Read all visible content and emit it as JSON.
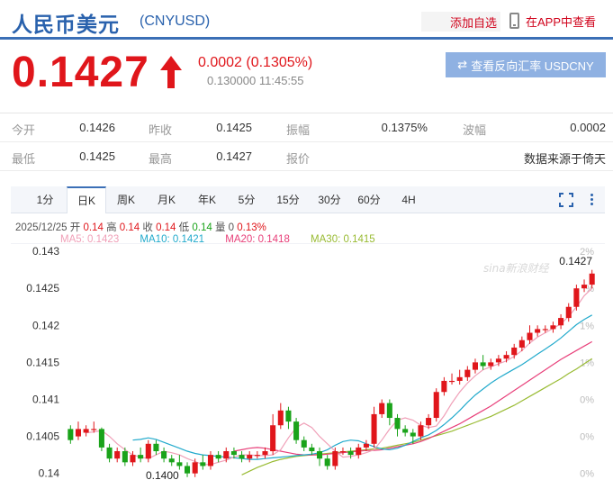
{
  "header": {
    "title": "人民币美元",
    "code": "(CNYUSD)",
    "add_favorite": "添加自选",
    "view_in_app": "在APP中查看"
  },
  "quote": {
    "price": "0.1427",
    "direction": "up",
    "change": "0.0002 (0.1305%)",
    "prev_value": "0.130000",
    "time": "11:45:55",
    "reverse_button": "查看反向汇率 USDCNY",
    "reverse_icon": "swap-arrows-icon",
    "up_color": "#e0161b",
    "down_color": "#1aa31a",
    "accent_color": "#2a62ad"
  },
  "stats": {
    "row1": [
      {
        "label": "今开",
        "value": "0.1426"
      },
      {
        "label": "昨收",
        "value": "0.1425"
      },
      {
        "label": "振幅",
        "value": "0.1375%"
      },
      {
        "label": "波幅",
        "value": "0.0002"
      }
    ],
    "row2": [
      {
        "label": "最低",
        "value": "0.1425"
      },
      {
        "label": "最高",
        "value": "0.1427"
      },
      {
        "label": "报价",
        "value": "数据来源于倚天"
      }
    ]
  },
  "tabs": [
    "1分",
    "日K",
    "周K",
    "月K",
    "年K",
    "5分",
    "15分",
    "30分",
    "60分",
    "4H"
  ],
  "active_tab": "日K",
  "ohlc": {
    "date": "2025/12/25",
    "open_label": "开",
    "open": "0.14",
    "high_label": "高",
    "high": "0.14",
    "close_label": "收",
    "close": "0.14",
    "low_label": "低",
    "low": "0.14",
    "vol_label": "量",
    "vol": "0",
    "pct": "0.13%"
  },
  "ma": [
    {
      "label": "MA5: 0.1423",
      "color": "#f0a0b8"
    },
    {
      "label": "MA10: 0.1421",
      "color": "#22aacc"
    },
    {
      "label": "MA20: 0.1418",
      "color": "#e8407a"
    },
    {
      "label": "MA30: 0.1415",
      "color": "#99bb33"
    }
  ],
  "watermark": "sina新浪财经",
  "chart_data": {
    "type": "candlestick",
    "y_ticks": [
      "0.143",
      "0.1425",
      "0.142",
      "0.1415",
      "0.141",
      "0.1405",
      "0.14"
    ],
    "right_ticks": [
      "2%",
      "%",
      "1%",
      "1%",
      "0%",
      "0%",
      "0%"
    ],
    "ylim": [
      0.13985,
      0.14305
    ],
    "annotations": {
      "max": "0.1427",
      "min": "0.1400"
    },
    "candles": [
      [
        0.1406,
        0.14045,
        0.14065,
        0.1404
      ],
      [
        0.1405,
        0.1406,
        0.1407,
        0.14045
      ],
      [
        0.14055,
        0.1406,
        0.14065,
        0.1405
      ],
      [
        0.1406,
        0.1406,
        0.1407,
        0.14055
      ],
      [
        0.1406,
        0.14035,
        0.14062,
        0.1403
      ],
      [
        0.14035,
        0.1402,
        0.1404,
        0.14015
      ],
      [
        0.1402,
        0.1403,
        0.14035,
        0.14015
      ],
      [
        0.1403,
        0.14015,
        0.14035,
        0.1401
      ],
      [
        0.14015,
        0.14025,
        0.1403,
        0.1401
      ],
      [
        0.14025,
        0.1402,
        0.14035,
        0.14015
      ],
      [
        0.1402,
        0.1404,
        0.14045,
        0.14015
      ],
      [
        0.1404,
        0.1403,
        0.14045,
        0.14025
      ],
      [
        0.1403,
        0.1402,
        0.14035,
        0.14015
      ],
      [
        0.1402,
        0.14015,
        0.14025,
        0.1401
      ],
      [
        0.14015,
        0.1401,
        0.14025,
        0.14005
      ],
      [
        0.1401,
        0.14,
        0.14015,
        0.13995
      ],
      [
        0.14,
        0.14015,
        0.1402,
        0.13995
      ],
      [
        0.14015,
        0.1401,
        0.14025,
        0.14005
      ],
      [
        0.1401,
        0.14025,
        0.1403,
        0.14005
      ],
      [
        0.14025,
        0.1402,
        0.1403,
        0.14015
      ],
      [
        0.1402,
        0.1403,
        0.14035,
        0.14015
      ],
      [
        0.1403,
        0.14025,
        0.14035,
        0.1402
      ],
      [
        0.14025,
        0.1402,
        0.1403,
        0.14015
      ],
      [
        0.1402,
        0.14025,
        0.1403,
        0.14015
      ],
      [
        0.14025,
        0.14025,
        0.1403,
        0.1402
      ],
      [
        0.14025,
        0.1403,
        0.14035,
        0.1402
      ],
      [
        0.1403,
        0.14065,
        0.1408,
        0.14025
      ],
      [
        0.14065,
        0.14085,
        0.14095,
        0.1406
      ],
      [
        0.14085,
        0.1407,
        0.1409,
        0.1406
      ],
      [
        0.1407,
        0.14045,
        0.14075,
        0.1404
      ],
      [
        0.14045,
        0.14035,
        0.1405,
        0.1403
      ],
      [
        0.14035,
        0.1403,
        0.1404,
        0.14025
      ],
      [
        0.1403,
        0.1402,
        0.14035,
        0.1401
      ],
      [
        0.1402,
        0.1401,
        0.14025,
        0.14005
      ],
      [
        0.1401,
        0.1403,
        0.14035,
        0.14005
      ],
      [
        0.1403,
        0.1403,
        0.14035,
        0.14025
      ],
      [
        0.1403,
        0.14025,
        0.14035,
        0.1402
      ],
      [
        0.14025,
        0.14035,
        0.1404,
        0.1402
      ],
      [
        0.14035,
        0.1404,
        0.14045,
        0.1403
      ],
      [
        0.1404,
        0.1408,
        0.1409,
        0.14035
      ],
      [
        0.1408,
        0.14095,
        0.141,
        0.14075
      ],
      [
        0.14095,
        0.14075,
        0.141,
        0.14065
      ],
      [
        0.14075,
        0.1406,
        0.1408,
        0.1405
      ],
      [
        0.1406,
        0.14055,
        0.14065,
        0.1405
      ],
      [
        0.14055,
        0.1405,
        0.1406,
        0.1404
      ],
      [
        0.1405,
        0.14065,
        0.1407,
        0.14045
      ],
      [
        0.14065,
        0.14075,
        0.1408,
        0.1406
      ],
      [
        0.14075,
        0.1411,
        0.14115,
        0.1407
      ],
      [
        0.1411,
        0.14125,
        0.1413,
        0.14105
      ],
      [
        0.14125,
        0.14125,
        0.14135,
        0.1412
      ],
      [
        0.14125,
        0.1413,
        0.1414,
        0.1412
      ],
      [
        0.1413,
        0.1414,
        0.14145,
        0.14125
      ],
      [
        0.1414,
        0.1415,
        0.14155,
        0.14135
      ],
      [
        0.1415,
        0.14145,
        0.1416,
        0.1414
      ],
      [
        0.14145,
        0.1415,
        0.14155,
        0.1414
      ],
      [
        0.1415,
        0.14155,
        0.1416,
        0.14145
      ],
      [
        0.14155,
        0.1416,
        0.14165,
        0.1415
      ],
      [
        0.1416,
        0.1417,
        0.14175,
        0.14155
      ],
      [
        0.1417,
        0.1418,
        0.14185,
        0.14165
      ],
      [
        0.1418,
        0.1419,
        0.142,
        0.14175
      ],
      [
        0.1419,
        0.14195,
        0.142,
        0.14185
      ],
      [
        0.14195,
        0.14195,
        0.142,
        0.1419
      ],
      [
        0.14195,
        0.142,
        0.14205,
        0.1419
      ],
      [
        0.142,
        0.1421,
        0.14215,
        0.14195
      ],
      [
        0.1421,
        0.14225,
        0.1423,
        0.14205
      ],
      [
        0.14225,
        0.1425,
        0.14255,
        0.1422
      ],
      [
        0.1425,
        0.14255,
        0.14262,
        0.14245
      ],
      [
        0.14255,
        0.1427,
        0.14275,
        0.1425
      ]
    ],
    "ma5": [
      0.14055,
      0.14056,
      0.14058,
      0.1405,
      0.1404,
      0.14032,
      0.14025,
      0.14022,
      0.1402,
      0.14025,
      0.1403,
      0.14028,
      0.14025,
      0.1402,
      0.14016,
      0.14012,
      0.14012,
      0.14015,
      0.14018,
      0.14022,
      0.14025,
      0.14025,
      0.14024,
      0.14024,
      0.14025,
      0.14032,
      0.14048,
      0.14062,
      0.14068,
      0.14062,
      0.1405,
      0.1404,
      0.1403,
      0.14022,
      0.14023,
      0.14025,
      0.14028,
      0.14032,
      0.14045,
      0.1406,
      0.14072,
      0.14075,
      0.14072,
      0.14065,
      0.14062,
      0.14064,
      0.14078,
      0.14095,
      0.1411,
      0.14122,
      0.14132,
      0.1414,
      0.14144,
      0.14148,
      0.14152,
      0.14158,
      0.14166,
      0.14176,
      0.14184,
      0.1419,
      0.14196,
      0.14202,
      0.14212,
      0.14225,
      0.1424,
      0.1425
    ],
    "ma10": [
      0.14045,
      0.14046,
      0.14048,
      0.14046,
      0.14042,
      0.14038,
      0.14034,
      0.1403,
      0.14027,
      0.14025,
      0.14024,
      0.14023,
      0.14022,
      0.14021,
      0.1402,
      0.14019,
      0.14019,
      0.1402,
      0.14021,
      0.14022,
      0.14023,
      0.14024,
      0.14025,
      0.14026,
      0.14028,
      0.14032,
      0.14038,
      0.14043,
      0.14045,
      0.14044,
      0.1404,
      0.14036,
      0.14033,
      0.14032,
      0.14034,
      0.14038,
      0.14043,
      0.14048,
      0.14052,
      0.14058,
      0.14066,
      0.14075,
      0.14085,
      0.14096,
      0.14106,
      0.14114,
      0.14122,
      0.14129,
      0.14135,
      0.14141,
      0.14147,
      0.14154,
      0.14161,
      0.14168,
      0.14175,
      0.14183,
      0.14192,
      0.14201,
      0.14208,
      0.14214
    ],
    "ma20": [
      0.1403,
      0.14032,
      0.14034,
      0.14035,
      0.14034,
      0.14032,
      0.1403,
      0.14028,
      0.14026,
      0.14025,
      0.14025,
      0.14025,
      0.14026,
      0.14027,
      0.14028,
      0.14029,
      0.1403,
      0.14031,
      0.14031,
      0.14032,
      0.14034,
      0.14036,
      0.14038,
      0.1404,
      0.14043,
      0.14047,
      0.14052,
      0.14057,
      0.14062,
      0.14067,
      0.14073,
      0.14079,
      0.14085,
      0.14091,
      0.14098,
      0.14105,
      0.14112,
      0.14119,
      0.14126,
      0.14133,
      0.1414,
      0.14147,
      0.14154,
      0.1416,
      0.14166,
      0.14172,
      0.14178
    ],
    "ma30": [
      0.13998,
      0.14003,
      0.14008,
      0.14012,
      0.14016,
      0.14019,
      0.14021,
      0.14023,
      0.14024,
      0.14025,
      0.14026,
      0.14027,
      0.14028,
      0.14029,
      0.1403,
      0.14031,
      0.14032,
      0.14033,
      0.14034,
      0.14036,
      0.14038,
      0.1404,
      0.14042,
      0.14045,
      0.14048,
      0.14051,
      0.14054,
      0.14057,
      0.14061,
      0.14065,
      0.14069,
      0.14073,
      0.14077,
      0.14082,
      0.14087,
      0.14092,
      0.14098,
      0.14104,
      0.1411,
      0.14116,
      0.14122,
      0.14128,
      0.14135,
      0.14141,
      0.14148,
      0.14155
    ]
  }
}
